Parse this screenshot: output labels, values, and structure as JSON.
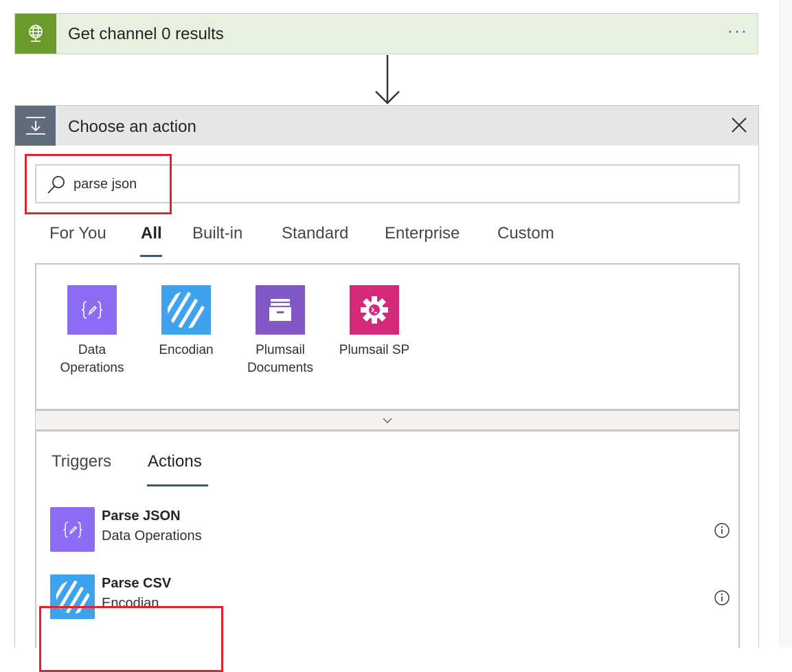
{
  "top_card": {
    "title": "Get channel 0 results",
    "more_label": "···",
    "icon": "globe-icon",
    "color": "#6d9a2d"
  },
  "action_panel": {
    "title": "Choose an action",
    "icon": "action-icon",
    "search": {
      "value": "parse json",
      "placeholder": ""
    },
    "tabs": [
      "For You",
      "All",
      "Built-in",
      "Standard",
      "Enterprise",
      "Custom"
    ],
    "active_tab": "All",
    "connectors": [
      {
        "label": "Data Operations",
        "icon": "data-operations-icon",
        "color": "#8c6cf5"
      },
      {
        "label": "Encodian",
        "icon": "encodian-icon",
        "color": "#3fa2ec"
      },
      {
        "label": "Plumsail Documents",
        "icon": "plumsail-documents-icon",
        "color": "#8158c6"
      },
      {
        "label": "Plumsail SP",
        "icon": "plumsail-sp-icon",
        "color": "#d3297a"
      }
    ],
    "sub_tabs": [
      "Triggers",
      "Actions"
    ],
    "active_sub_tab": "Actions",
    "actions": [
      {
        "title": "Parse JSON",
        "subtitle": "Data Operations",
        "icon": "data-operations-icon",
        "color": "#8c6cf5"
      },
      {
        "title": "Parse CSV",
        "subtitle": "Encodian",
        "icon": "encodian-icon",
        "color": "#3fa2ec"
      }
    ]
  },
  "colors": {
    "highlight": "#e1232e",
    "tab_underline": "#2b5f7c"
  }
}
